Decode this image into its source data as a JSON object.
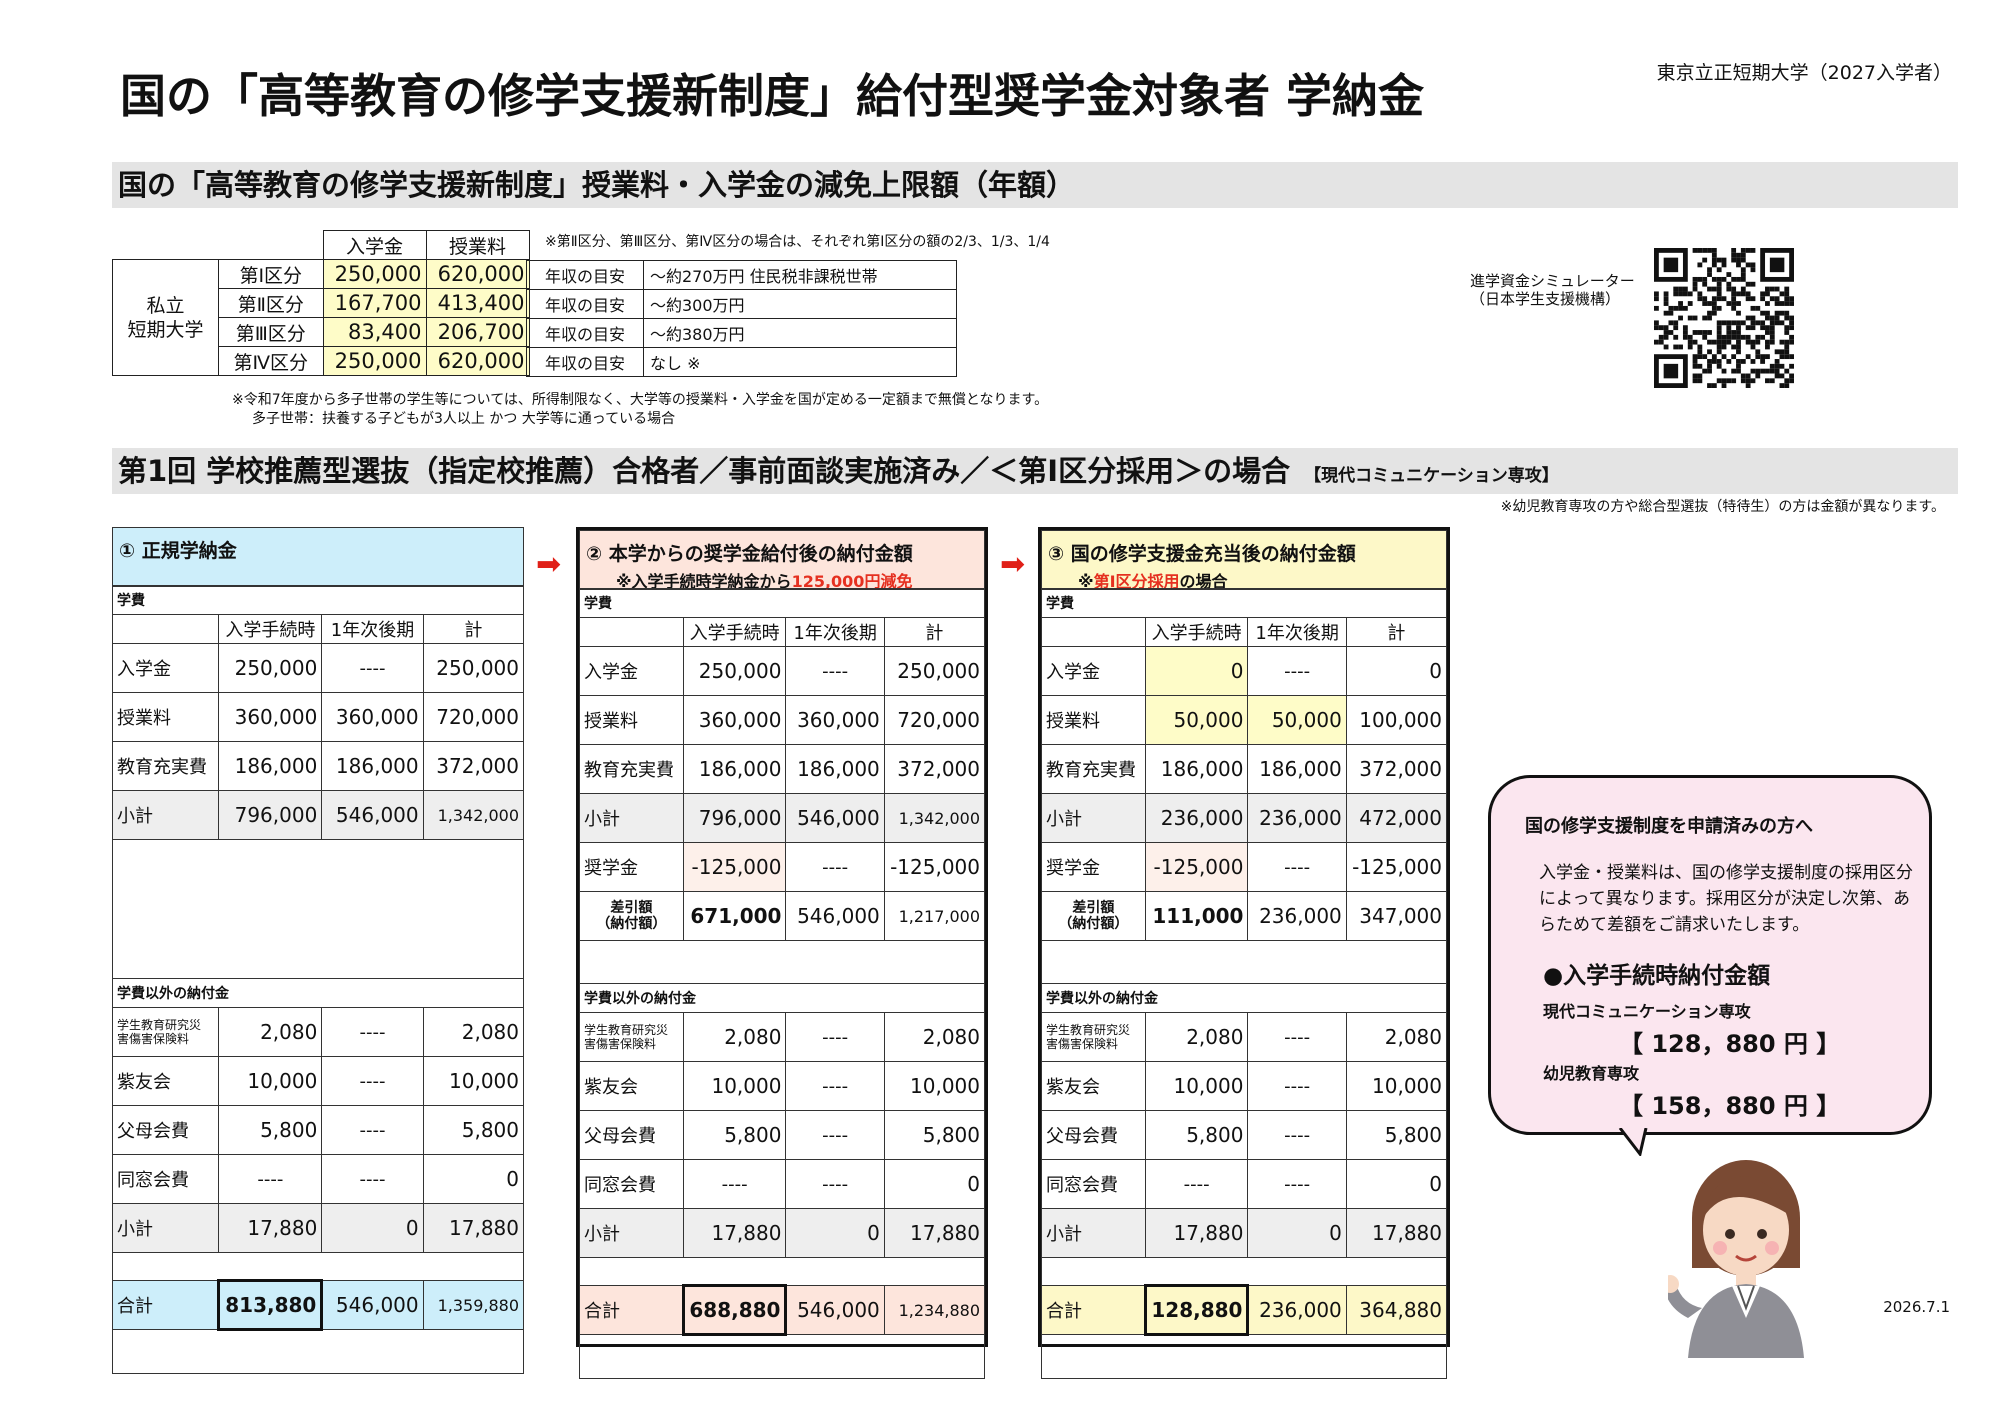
{
  "header": {
    "title": "国の「高等教育の修学支援新制度」給付型奨学金対象者 学納金",
    "school": "東京立正短期大学（2027入学者）"
  },
  "limits": {
    "band_title": "国の「高等教育の修学支援新制度」授業料・入学金の減免上限額（年額）",
    "col_enroll": "入学金",
    "col_tuition": "授業料",
    "school_type": "私立\n短期大学",
    "note_top": "※第Ⅱ区分、第Ⅲ区分、第Ⅳ区分の場合は、それぞれ第Ⅰ区分の額の2/3、1/3、1/4",
    "rows": [
      {
        "kubun": "第Ⅰ区分",
        "enroll": "250,000",
        "tuition": "620,000",
        "label": "年収の目安",
        "income": "～約270万円  住民税非課税世帯"
      },
      {
        "kubun": "第Ⅱ区分",
        "enroll": "167,700",
        "tuition": "413,400",
        "label": "年収の目安",
        "income": "～約300万円"
      },
      {
        "kubun": "第Ⅲ区分",
        "enroll": "83,400",
        "tuition": "206,700",
        "label": "年収の目安",
        "income": "～約380万円"
      },
      {
        "kubun": "第Ⅳ区分",
        "enroll": "250,000",
        "tuition": "620,000",
        "label": "年収の目安",
        "income": "なし ※"
      }
    ],
    "note_bottom_1": "※令和7年度から多子世帯の学生等については、所得制限なく、大学等の授業料・入学金を国が定める一定額まで無償となります。",
    "note_bottom_2": "多子世帯：扶養する子どもが3人以上  かつ  大学等に通っている場合"
  },
  "qr": {
    "label_1": "進学資金シミュレーター",
    "label_2": "（日本学生支援機構）"
  },
  "case": {
    "band_title": "第1回 学校推薦型選抜（指定校推薦）合格者／事前面談実施済み／＜第Ⅰ区分採用＞の場合",
    "band_small": "【現代コミュニケーション専攻】",
    "right_note": "※幼児教育専攻の方や総合型選抜（特待生）の方は金額が異なります。"
  },
  "common": {
    "gakuhi": "学費",
    "col_a": "入学手続時",
    "col_b": "1年次後期",
    "col_c": "計",
    "other_fees": "学費以外の納付金",
    "dash": "----"
  },
  "panels": [
    {
      "title": "① 正規学納金",
      "sub1": "",
      "sub_red": "",
      "sub2": "",
      "rows": [
        [
          "入学金",
          "250,000",
          "----",
          "250,000"
        ],
        [
          "授業料",
          "360,000",
          "360,000",
          "720,000"
        ],
        [
          "教育充実費",
          "186,000",
          "186,000",
          "372,000"
        ],
        [
          "小計",
          "796,000",
          "546,000",
          "1,342,000"
        ]
      ],
      "scholar": null,
      "diff": null,
      "other": [
        [
          "学生教育研究災\n害傷害保険料",
          "2,080",
          "----",
          "2,080"
        ],
        [
          "紫友会",
          "10,000",
          "----",
          "10,000"
        ],
        [
          "父母会費",
          "5,800",
          "----",
          "5,800"
        ],
        [
          "同窓会費",
          "----",
          "----",
          "0"
        ],
        [
          "小計",
          "17,880",
          "0",
          "17,880"
        ]
      ],
      "total": [
        "合計",
        "813,880",
        "546,000",
        "1,359,880"
      ],
      "accent": "#cdeefa"
    },
    {
      "title": "② 本学からの奨学金給付後の納付金額",
      "sub1": "※入学手続時学納金から",
      "sub_red": "125,000円減免",
      "sub2": "",
      "rows": [
        [
          "入学金",
          "250,000",
          "----",
          "250,000"
        ],
        [
          "授業料",
          "360,000",
          "360,000",
          "720,000"
        ],
        [
          "教育充実費",
          "186,000",
          "186,000",
          "372,000"
        ],
        [
          "小計",
          "796,000",
          "546,000",
          "1,342,000"
        ]
      ],
      "scholar": [
        "奨学金",
        "-125,000",
        "----",
        "-125,000"
      ],
      "diff": [
        "差引額\n（納付額）",
        "671,000",
        "546,000",
        "1,217,000"
      ],
      "other": [
        [
          "学生教育研究災\n害傷害保険料",
          "2,080",
          "----",
          "2,080"
        ],
        [
          "紫友会",
          "10,000",
          "----",
          "10,000"
        ],
        [
          "父母会費",
          "5,800",
          "----",
          "5,800"
        ],
        [
          "同窓会費",
          "----",
          "----",
          "0"
        ],
        [
          "小計",
          "17,880",
          "0",
          "17,880"
        ]
      ],
      "total": [
        "合計",
        "688,880",
        "546,000",
        "1,234,880"
      ],
      "accent": "#fde5dc"
    },
    {
      "title": "③ 国の修学支援金充当後の納付金額",
      "sub1": "※",
      "sub_red": "第Ⅰ区分採用",
      "sub2": "の場合",
      "rows": [
        [
          "入学金",
          "0",
          "----",
          "0"
        ],
        [
          "授業料",
          "50,000",
          "50,000",
          "100,000"
        ],
        [
          "教育充実費",
          "186,000",
          "186,000",
          "372,000"
        ],
        [
          "小計",
          "236,000",
          "236,000",
          "472,000"
        ]
      ],
      "scholar": [
        "奨学金",
        "-125,000",
        "----",
        "-125,000"
      ],
      "diff": [
        "差引額\n（納付額）",
        "111,000",
        "236,000",
        "347,000"
      ],
      "other": [
        [
          "学生教育研究災\n害傷害保険料",
          "2,080",
          "----",
          "2,080"
        ],
        [
          "紫友会",
          "10,000",
          "----",
          "10,000"
        ],
        [
          "父母会費",
          "5,800",
          "----",
          "5,800"
        ],
        [
          "同窓会費",
          "----",
          "----",
          "0"
        ],
        [
          "小計",
          "17,880",
          "0",
          "17,880"
        ]
      ],
      "total": [
        "合計",
        "128,880",
        "236,000",
        "364,880"
      ],
      "accent": "#fdf8c8"
    }
  ],
  "bubble": {
    "head": "国の修学支援制度を申請済みの方へ",
    "body": "入学金・授業料は、国の修学支援制度の採用区分によって異なります。採用区分が決定し次第、あらためて差額をご請求いたします。",
    "subtitle": "●入学手続時納付金額",
    "course1": "現代コミュニケーション専攻",
    "amount1": "【  128，880 円  】",
    "course2": "幼児教育専攻",
    "amount2": "【  158，880 円  】"
  },
  "colors": {
    "band": "#e4e4e4",
    "arrow": "#e02018",
    "bubble": "#fbe6ef",
    "yellow": "#fefcc8"
  },
  "footer": {
    "date": "2026.7.1"
  }
}
